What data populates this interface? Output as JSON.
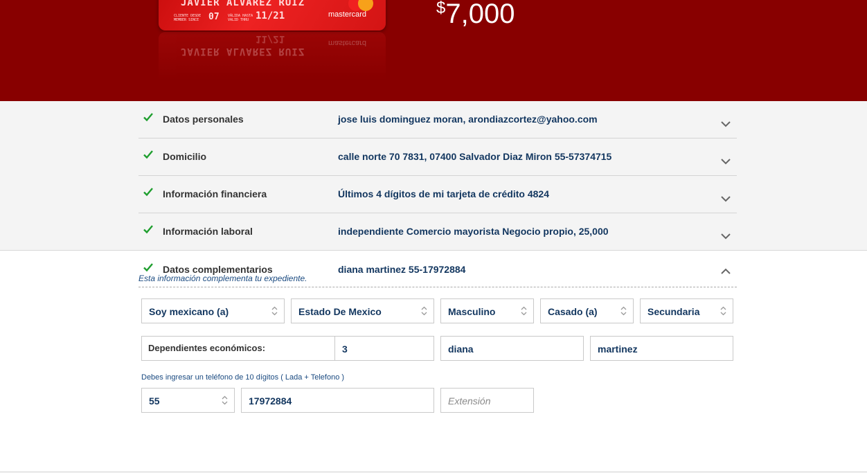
{
  "hero": {
    "card": {
      "holder_name": "JAVIER ALVAREZ RUIZ",
      "client_since_label": "CLIENTE DESDE\nMEMBER SINCE",
      "client_since_value": "07",
      "valid_thru_label": "VÁLIDA HASTA\nVALID THRU",
      "valid_thru_value": "11/21",
      "brand": "mastercard"
    },
    "amount_currency": "$",
    "amount_value": "7,000"
  },
  "sections": [
    {
      "title": "Datos personales",
      "value": "jose luis dominguez moran, arondiazcortez@yahoo.com",
      "status": "complete"
    },
    {
      "title": "Domicilio",
      "value": "calle norte 70 7831, 07400 Salvador Diaz Miron 55-57374715",
      "status": "complete"
    },
    {
      "title": "Información financiera",
      "value": "Últimos 4 dígitos de mi tarjeta de crédito 4824",
      "status": "complete"
    },
    {
      "title": "Información laboral",
      "value": "independiente Comercio mayorista Negocio propio, 25,000",
      "status": "complete"
    }
  ],
  "open_section": {
    "title": "Datos complementarios",
    "value": "diana martinez 55-17972884",
    "subtitle": "Esta información complementa tu expediente."
  },
  "form": {
    "nationality": "Soy mexicano (a)",
    "state": "Estado De Mexico",
    "gender": "Masculino",
    "marital_status": "Casado (a)",
    "education": "Secundaria",
    "dependents_label": "Dependientes económicos:",
    "dependents_value": "3",
    "ref_first_name": "diana",
    "ref_last_name": "martinez",
    "phone_hint": "Debes ingresar un teléfono de 10 dígitos ( Lada + Telefono )",
    "lada": "55",
    "phone": "17972884",
    "extension_placeholder": "Extensión"
  },
  "colors": {
    "hero_bg": "#880000",
    "check": "#1e9e2e",
    "value_text": "#12365f"
  }
}
